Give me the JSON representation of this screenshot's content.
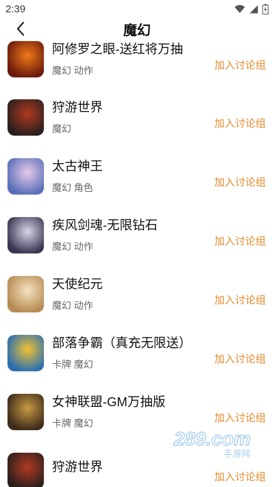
{
  "status_bar": {
    "time": "2:39"
  },
  "header": {
    "title": "魔幻"
  },
  "games": [
    {
      "name": "阿修罗之眼-送红将万抽",
      "tags": "魔幻 动作",
      "action": "加入讨论组",
      "colors": [
        "#6b1a0c",
        "#f07a1a"
      ]
    },
    {
      "name": "狩游世界",
      "tags": "魔幻",
      "action": "加入讨论组",
      "colors": [
        "#2a1f1c",
        "#b13a22"
      ]
    },
    {
      "name": "太古神王",
      "tags": "魔幻 角色",
      "action": "加入讨论组",
      "colors": [
        "#5a6fb8",
        "#e6c9e9"
      ]
    },
    {
      "name": "疾风剑魂-无限钻石",
      "tags": "魔幻 动作",
      "action": "加入讨论组",
      "colors": [
        "#3a3550",
        "#d8d3e6"
      ]
    },
    {
      "name": "天使纪元",
      "tags": "魔幻 动作",
      "action": "加入讨论组",
      "colors": [
        "#b78a52",
        "#f3e2c0"
      ]
    },
    {
      "name": "部落争霸（真充无限送）",
      "tags": "卡牌 魔幻",
      "action": "加入讨论组",
      "colors": [
        "#2b6fb0",
        "#f1c232"
      ]
    },
    {
      "name": "女神联盟-GM万抽版",
      "tags": "卡牌 魔幻",
      "action": "加入讨论组",
      "colors": [
        "#3c2a1a",
        "#c89a44"
      ]
    },
    {
      "name": "狩游世界",
      "tags": "",
      "action": "加入讨论组",
      "colors": [
        "#2a1f1c",
        "#b13a22"
      ]
    }
  ],
  "watermark": {
    "text": "289.com",
    "subtext": "手游网"
  }
}
